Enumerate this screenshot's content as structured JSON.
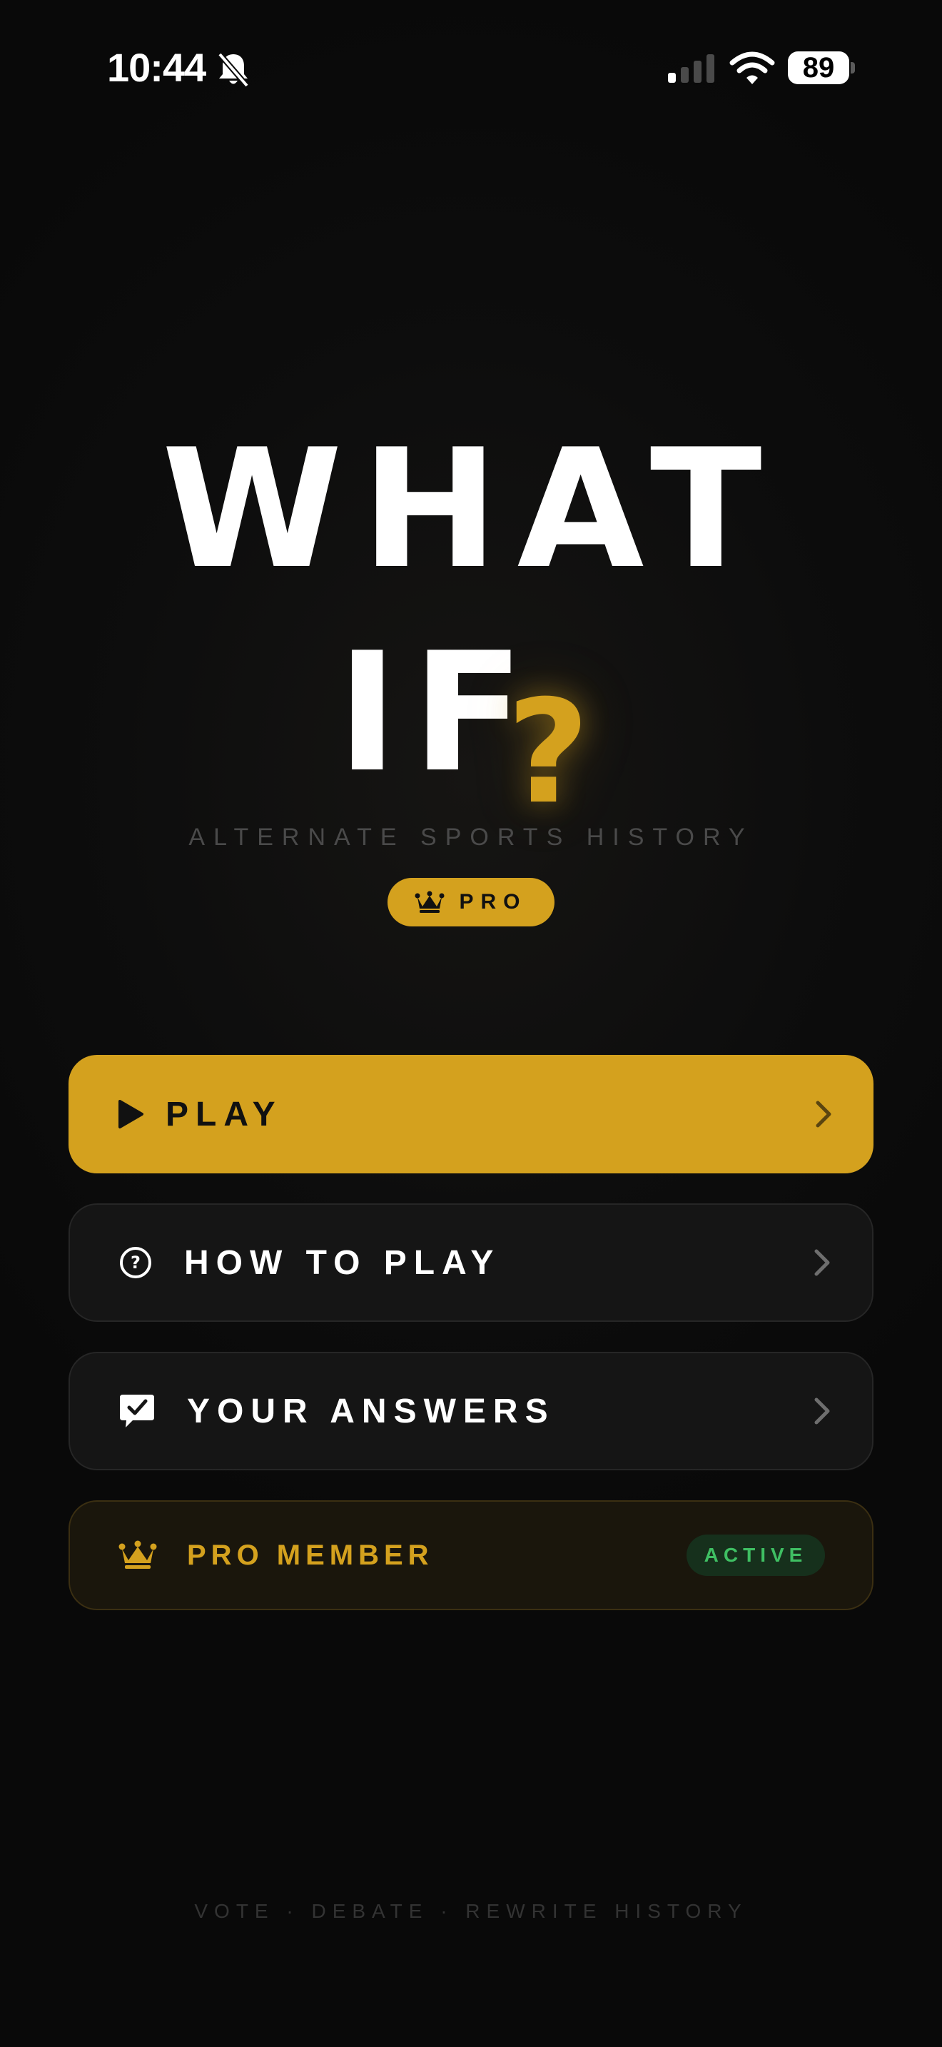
{
  "status_bar": {
    "time": "10:44",
    "battery": "89",
    "icons": [
      "bell-slash-icon",
      "cellular-signal-icon",
      "wifi-icon",
      "battery-icon"
    ]
  },
  "hero": {
    "title_line1": "WHAT",
    "title_line2": "IF",
    "question_mark": "?",
    "subtitle": "ALTERNATE SPORTS HISTORY",
    "badge_label": "PRO",
    "badge_icon": "crown-icon"
  },
  "menu": {
    "play": {
      "label": "PLAY",
      "icon": "play-icon"
    },
    "how_to_play": {
      "label": "HOW TO PLAY",
      "icon": "question-circle-icon"
    },
    "your_answers": {
      "label": "YOUR ANSWERS",
      "icon": "chat-check-icon"
    },
    "pro_member": {
      "label": "PRO MEMBER",
      "status": "ACTIVE",
      "icon": "crown-icon"
    }
  },
  "footer": {
    "tagline": "VOTE · DEBATE · REWRITE HISTORY"
  },
  "colors": {
    "background": "#0b0b0b",
    "accent_gold": "#d4a11e",
    "card": "#151515",
    "active_green": "#3fbf63"
  }
}
